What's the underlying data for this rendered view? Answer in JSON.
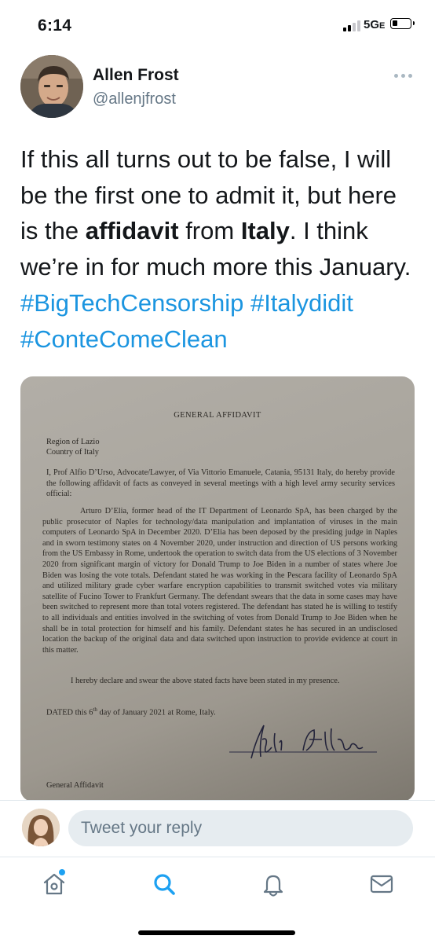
{
  "status_bar": {
    "time": "6:14",
    "network": "5G",
    "network_suffix": "E"
  },
  "tweet": {
    "author_name": "Allen Frost",
    "author_handle": "@allenjfrost",
    "text_part1": "If this all turns out to be false, I will be the first one to admit it, but here is the ",
    "bold1": "affidavit",
    "text_part2": " from ",
    "bold2": "Italy",
    "text_part3": ". I think we’re in for much more this January. ",
    "hashtags": [
      "#BigTechCensorship",
      "#Italydidit",
      "#ConteComeClean"
    ]
  },
  "document": {
    "title": "GENERAL AFFIDAVIT",
    "region": "Region of Lazio",
    "country": "Country of Italy",
    "intro": "I, Prof Alfio D’Urso, Advocate/Lawyer, of Via Vittorio Emanuele, Catania, 95131 Italy, do hereby provide the following affidavit of facts as conveyed in several meetings with a high level army security services official:",
    "body": "Arturo D’Elia, former head of the IT Department of Leonardo SpA, has been charged by the public prosecutor of Naples for technology/data manipulation and implantation of viruses in the main computers of Leonardo SpA in December 2020. D’Elia has been deposed by the presiding judge in Naples and in sworn testimony states on 4 November 2020, under instruction and direction of US persons working from the US Embassy in Rome, undertook the operation to switch data from the US elections of 3 November 2020 from significant margin of victory for Donald Trump to Joe Biden in a number of states where Joe Biden was losing the vote totals. Defendant stated he was working in the Pescara facility of Leonardo SpA and utilized military grade cyber warfare encryption capabilities to transmit switched votes via military satellite of Fucino Tower to Frankfurt Germany. The defendant swears that the data in some cases may have been switched to represent more than total voters registered. The defendant has stated he is willing to testify to all individuals and entities involved in the switching of votes from Donald Trump to Joe Biden when he shall be in total protection for himself and his family. Defendant states he has secured in an undisclosed location the backup of the original data and data switched upon instruction to provide evidence at court in this matter.",
    "declaration": "I hereby declare and swear the above stated facts have been stated in my presence.",
    "dated_prefix": "DATED this 6",
    "dated_sup": "th",
    "dated_suffix": " day of January 2021 at Rome, Italy.",
    "footer": "General Affidavit"
  },
  "reply": {
    "placeholder": "Tweet your reply"
  },
  "tabs": [
    "home-icon",
    "search-icon",
    "notifications-icon",
    "messages-icon"
  ],
  "colors": {
    "accent": "#1da1f2",
    "hashtag": "#1b95e0",
    "secondary_text": "#657786"
  }
}
